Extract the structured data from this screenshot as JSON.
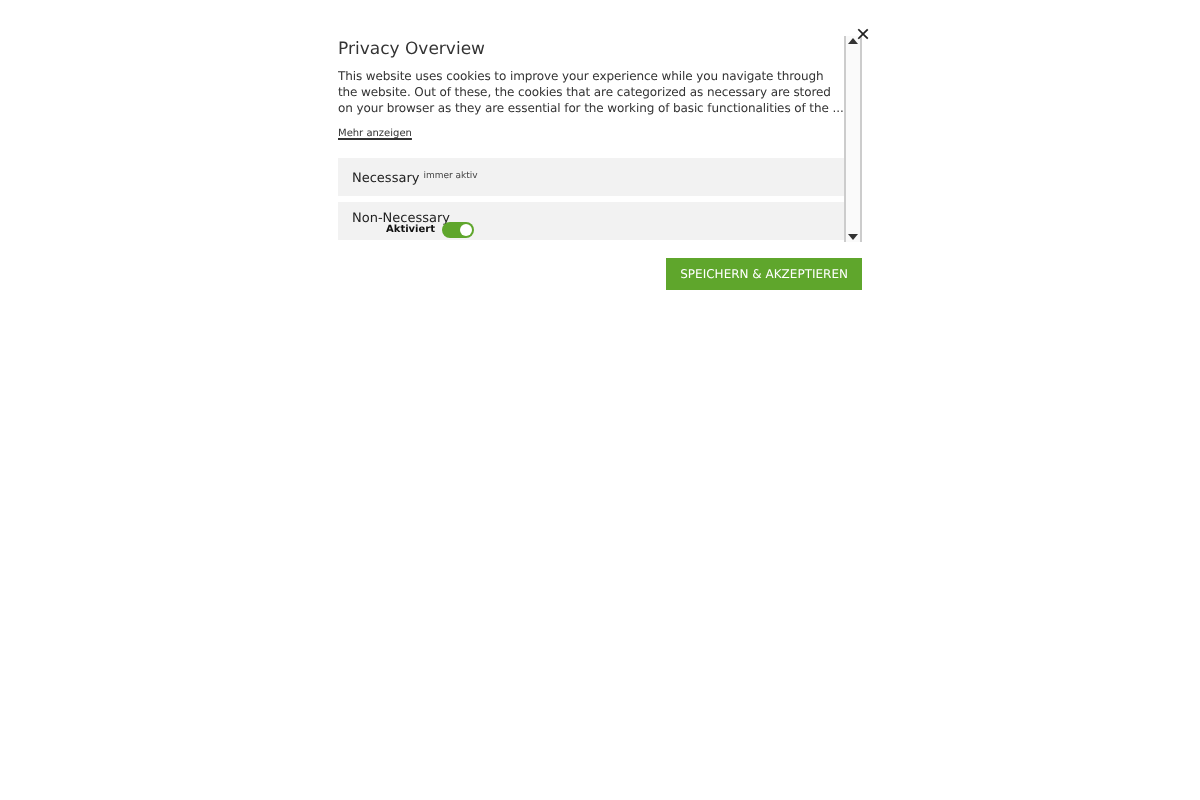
{
  "close": "×",
  "title": "Privacy Overview",
  "description": "This website uses cookies to improve your experience while you navigate through the website. Out of these, the cookies that are categorized as necessary are stored on your browser as they are essential for the working of basic functionalities of the ...",
  "more_link": "Mehr anzeigen",
  "categories": [
    {
      "kind": "always",
      "name": "Necessary",
      "note": "immer aktiv"
    },
    {
      "kind": "toggle",
      "name": "Non-Necessary",
      "note": "Aktiviert",
      "on": true
    }
  ],
  "save_button": "SPEICHERN & AKZEPTIEREN"
}
